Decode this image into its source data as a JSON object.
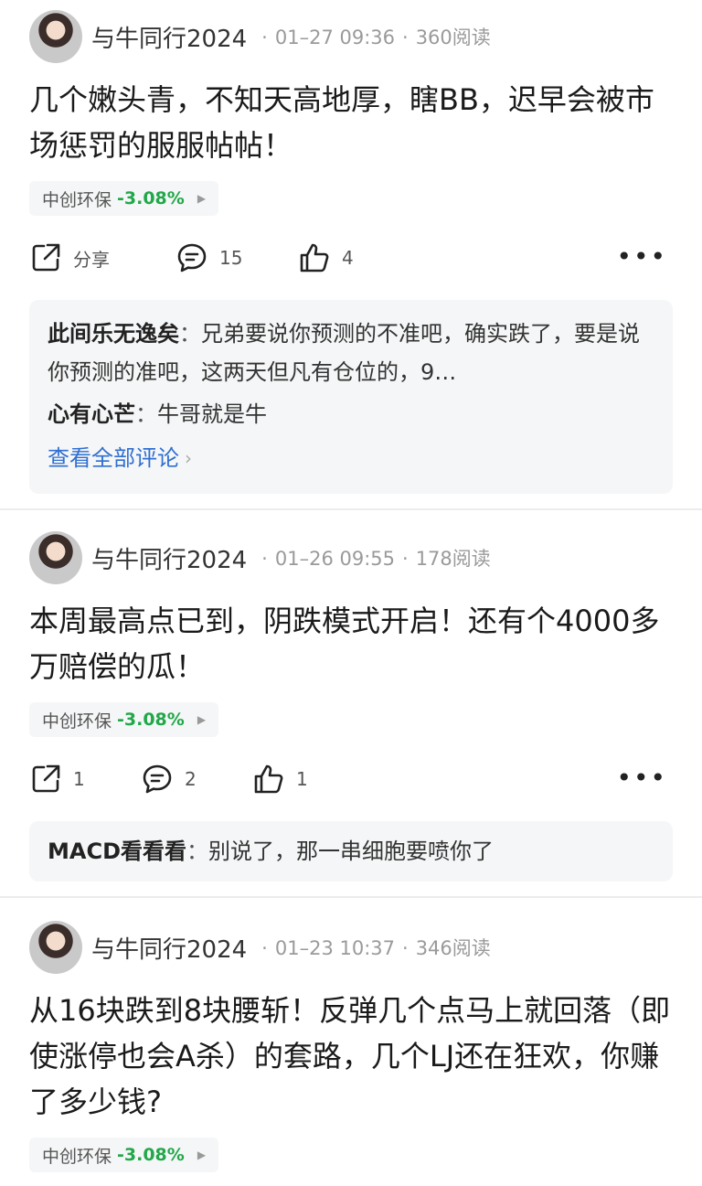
{
  "posts": [
    {
      "author": "与牛同行2024",
      "time": "01–27 09:36",
      "reads": "360阅读",
      "content": "几个嫩头青，不知天高地厚，瞎BB，迟早会被市场惩罚的服服帖帖！",
      "stock": {
        "name": "中创环保",
        "change": "-3.08%"
      },
      "actions": {
        "share": "分享",
        "comments": "15",
        "likes": "4"
      },
      "comments": [
        {
          "user": "此间乐无逸矣",
          "text": "兄弟要说你预测的不准吧，确实跌了，要是说你预测的准吧，这两天但凡有仓位的，9…"
        },
        {
          "user": "心有心芒",
          "text": "牛哥就是牛"
        }
      ],
      "view_all": "查看全部评论"
    },
    {
      "author": "与牛同行2024",
      "time": "01–26 09:55",
      "reads": "178阅读",
      "content": "本周最高点已到，阴跌模式开启！还有个4000多万赔偿的瓜！",
      "stock": {
        "name": "中创环保",
        "change": "-3.08%"
      },
      "actions": {
        "share": "1",
        "comments": "2",
        "likes": "1"
      },
      "comments": [
        {
          "user": "MACD看看看",
          "text": "别说了，那一串细胞要喷你了"
        }
      ]
    },
    {
      "author": "与牛同行2024",
      "time": "01–23 10:37",
      "reads": "346阅读",
      "content": "从16块跌到8块腰斩！反弹几个点马上就回落（即使涨停也会A杀）的套路，几个LJ还在狂欢，你赚了多少钱?",
      "stock": {
        "name": "中创环保",
        "change": "-3.08%"
      }
    }
  ],
  "ui": {
    "more": "•••",
    "sep": "：",
    "dot": "·"
  },
  "colors": {
    "down": "#22a84a",
    "link": "#2f6fd1"
  }
}
